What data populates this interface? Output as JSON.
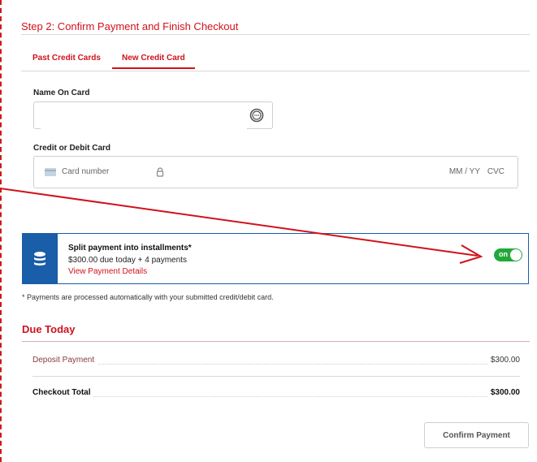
{
  "checkout": {
    "step_title": "Step 2: Confirm Payment and Finish Checkout",
    "tabs": [
      {
        "label": "Past Credit Cards",
        "active": false
      },
      {
        "label": "New Credit Card",
        "active": true
      }
    ],
    "name_on_card": {
      "label": "Name On Card",
      "value": ""
    },
    "card": {
      "label": "Credit or Debit Card",
      "number_placeholder": "Card number",
      "expiry_placeholder": "MM / YY",
      "cvc_placeholder": "CVC"
    },
    "installments": {
      "title": "Split payment into installments*",
      "summary": "$300.00 due today + 4 payments",
      "details_link": "View Payment Details",
      "toggle_label": "on",
      "toggle_on": true
    },
    "footnote": "* Payments are processed automatically with your submitted credit/debit card.",
    "due_today": {
      "title": "Due Today",
      "deposit_label": "Deposit Payment",
      "deposit_value": "$300.00",
      "total_label": "Checkout Total",
      "total_value": "$300.00"
    },
    "confirm_label": "Confirm Payment"
  },
  "colors": {
    "brand_red": "#d0121b",
    "installment_blue": "#1a5da8",
    "toggle_green": "#22a83a"
  },
  "icons": [
    "chat-bubble-icon",
    "card-icon",
    "lock-icon",
    "database-icon"
  ]
}
